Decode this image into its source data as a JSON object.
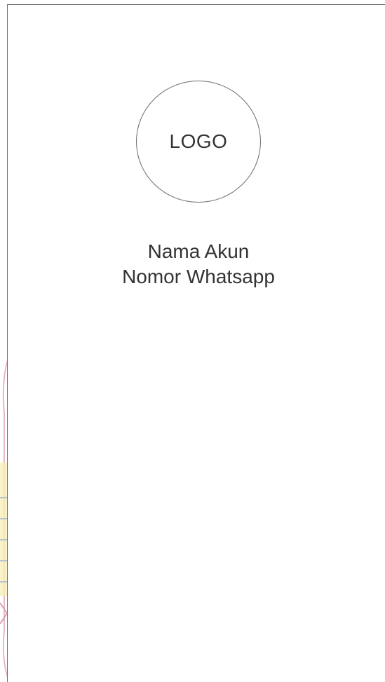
{
  "logo": {
    "text": "LOGO"
  },
  "account": {
    "name_label": "Nama Akun",
    "phone_label": "Nomor Whatsapp"
  },
  "colors": {
    "outline": "#6e6e6e",
    "text": "#333333",
    "background": "#ffffff"
  }
}
